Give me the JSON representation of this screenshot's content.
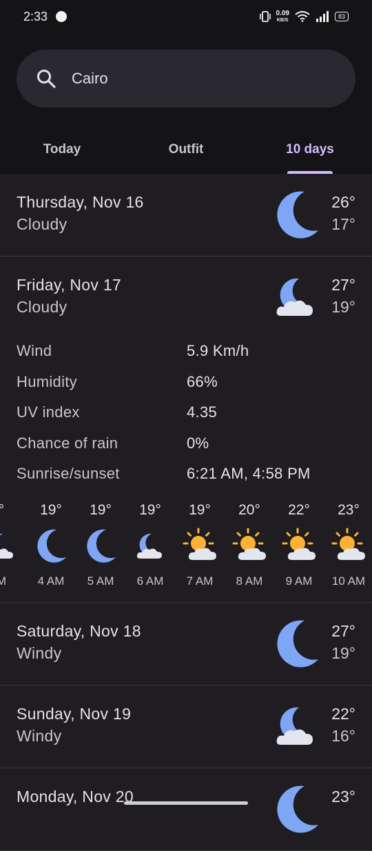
{
  "status_bar": {
    "time": "2:33",
    "net_speed_value": "0.09",
    "net_speed_unit": "KB/S",
    "battery": "83"
  },
  "search": {
    "value": "Cairo"
  },
  "tabs": [
    {
      "label": "Today",
      "active": false
    },
    {
      "label": "Outfit",
      "active": false
    },
    {
      "label": "10 days",
      "active": true
    }
  ],
  "days": [
    {
      "date": "Thursday, Nov 16",
      "condition": "Cloudy",
      "high": "26°",
      "low": "17°",
      "icon": "moon-icon"
    },
    {
      "date": "Friday, Nov 17",
      "condition": "Cloudy",
      "high": "27°",
      "low": "19°",
      "icon": "moon-cloud-icon"
    },
    {
      "date": "Saturday, Nov 18",
      "condition": "Windy",
      "high": "27°",
      "low": "19°",
      "icon": "moon-icon"
    },
    {
      "date": "Sunday, Nov 19",
      "condition": "Windy",
      "high": "22°",
      "low": "16°",
      "icon": "moon-cloud-icon"
    },
    {
      "date": "Monday, Nov 20",
      "condition": "",
      "high": "23°",
      "low": "",
      "icon": "moon-icon"
    }
  ],
  "details": [
    {
      "label": "Wind",
      "value": "5.9 Km/h"
    },
    {
      "label": "Humidity",
      "value": "66%"
    },
    {
      "label": "UV index",
      "value": "4.35"
    },
    {
      "label": "Chance of rain",
      "value": "0%"
    },
    {
      "label": "Sunrise/sunset",
      "value": "6:21 AM, 4:58 PM"
    }
  ],
  "hourly": [
    {
      "temp": "°",
      "time": "M",
      "icon": "moon-cloud-icon"
    },
    {
      "temp": "19°",
      "time": "4 AM",
      "icon": "moon-icon"
    },
    {
      "temp": "19°",
      "time": "5 AM",
      "icon": "moon-icon"
    },
    {
      "temp": "19°",
      "time": "6 AM",
      "icon": "moon-cloud-icon"
    },
    {
      "temp": "19°",
      "time": "7 AM",
      "icon": "sun-cloud-icon"
    },
    {
      "temp": "20°",
      "time": "8 AM",
      "icon": "sun-cloud-icon"
    },
    {
      "temp": "22°",
      "time": "9 AM",
      "icon": "sun-cloud-icon"
    },
    {
      "temp": "23°",
      "time": "10 AM",
      "icon": "sun-cloud-icon"
    }
  ],
  "colors": {
    "accent": "#d0bcff",
    "moon": "#7ea6f5",
    "sun": "#fbb234",
    "cloud": "#e3e6ec"
  }
}
